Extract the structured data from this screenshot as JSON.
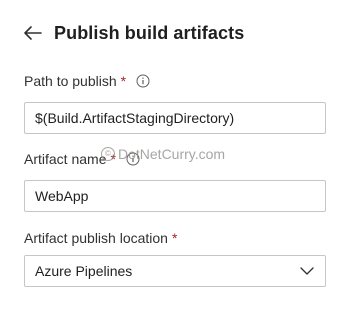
{
  "header": {
    "title": "Publish build artifacts"
  },
  "fields": {
    "path_to_publish": {
      "label": "Path to publish",
      "required_marker": "*",
      "value": "$(Build.ArtifactStagingDirectory)"
    },
    "artifact_name": {
      "label": "Artifact name",
      "required_marker": "*",
      "value": "WebApp"
    },
    "artifact_publish_location": {
      "label": "Artifact publish location",
      "required_marker": "*",
      "value": "Azure Pipelines"
    }
  },
  "watermark": {
    "text": "DotNetCurry.com"
  },
  "icons": {
    "back": "back-arrow-icon",
    "info": "info-icon",
    "dropdown": "chevron-down-icon"
  }
}
